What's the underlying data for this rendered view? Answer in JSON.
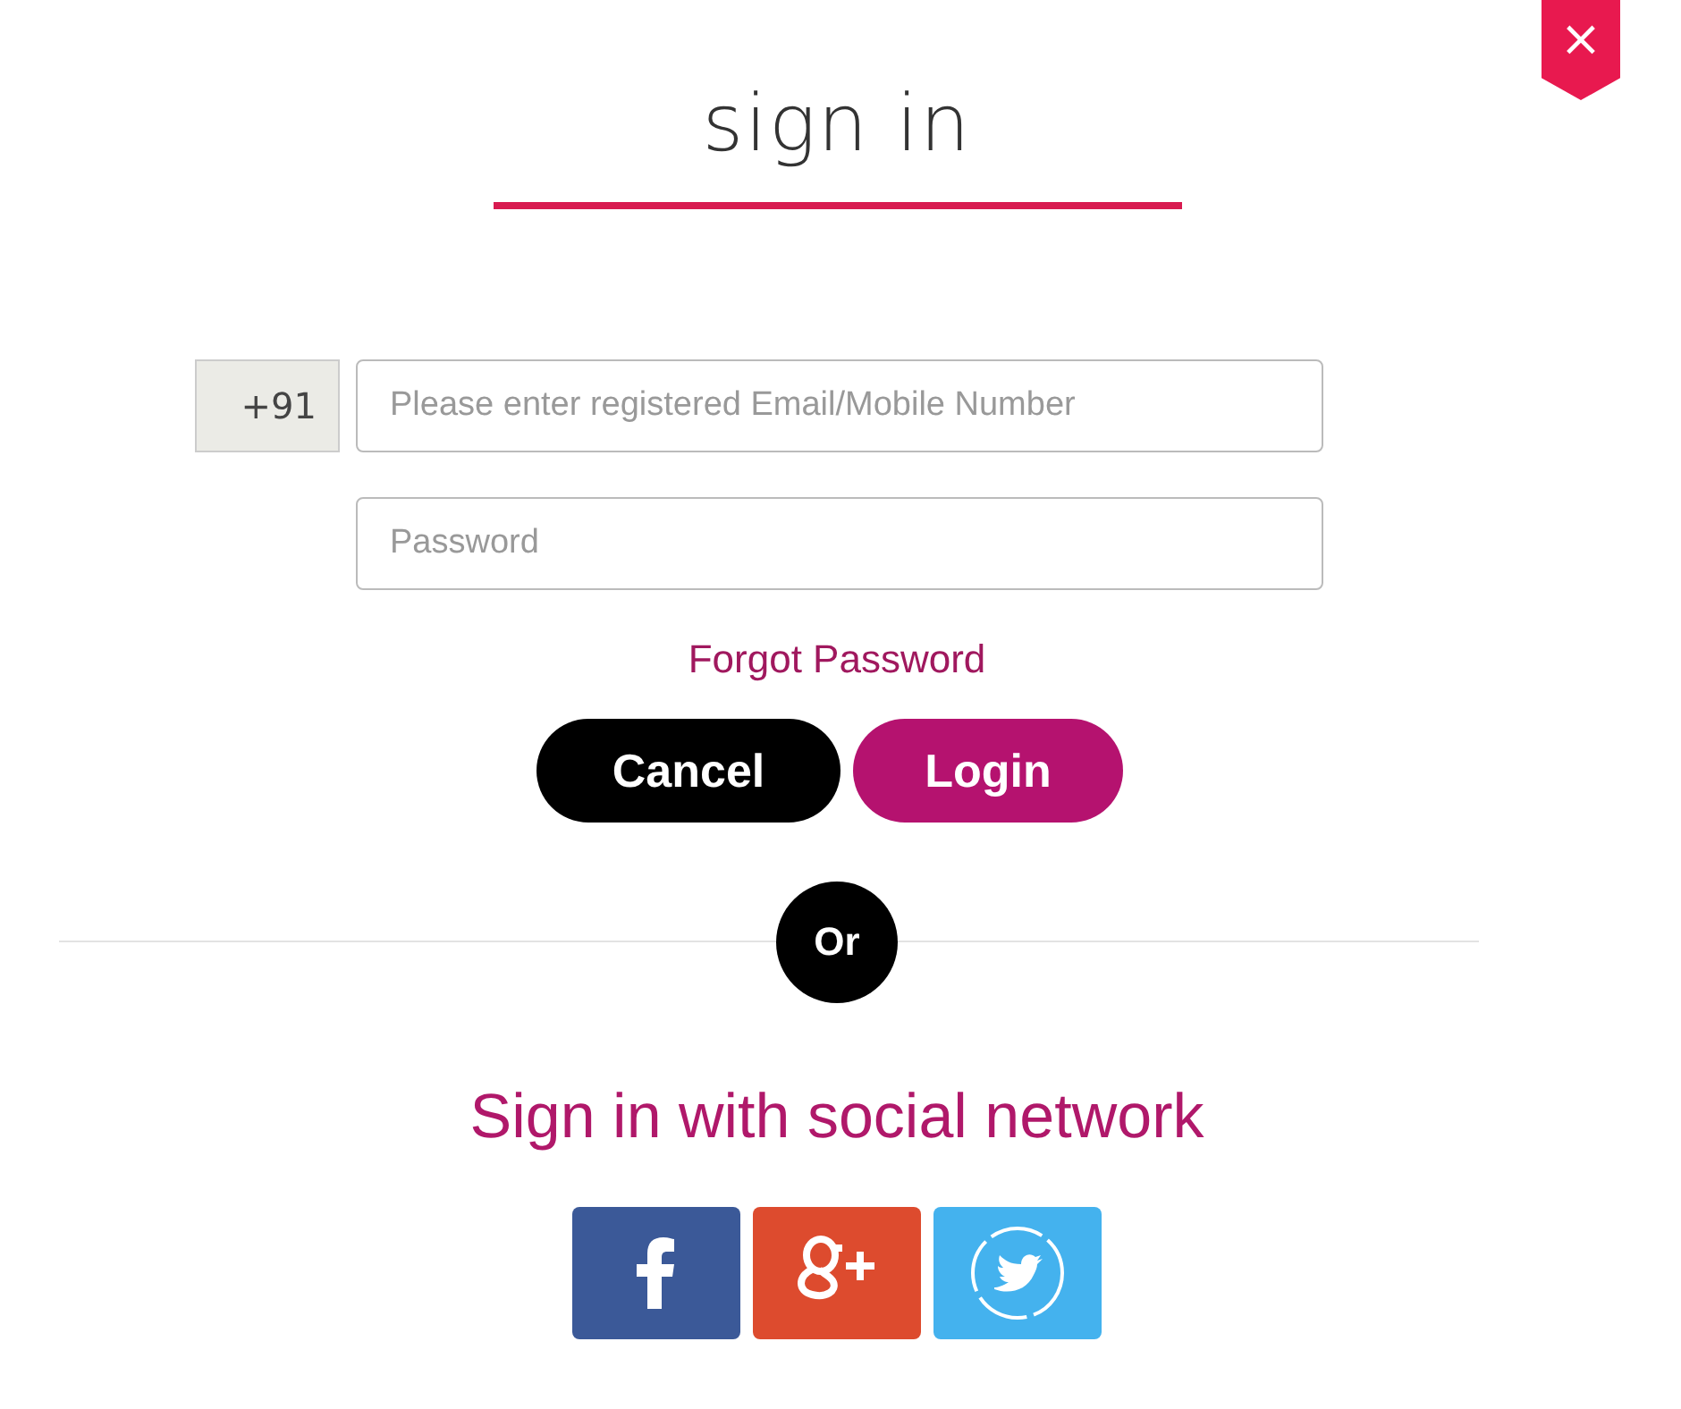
{
  "close_button": {
    "label": "×"
  },
  "title": "sign in",
  "form": {
    "country_code": "+91",
    "login_field": {
      "placeholder": "Please enter registered Email/Mobile Number"
    },
    "password_field": {
      "placeholder": "Password"
    },
    "forgot_link": "Forgot Password"
  },
  "buttons": [
    {
      "label": "Cancel",
      "kind": "cancel"
    },
    {
      "label": "Login",
      "kind": "login"
    }
  ],
  "separator": "Or",
  "social": {
    "heading": "Sign in with social network",
    "networks": [
      {
        "kind": "facebook"
      },
      {
        "kind": "googleplus"
      },
      {
        "kind": "twitter"
      }
    ]
  }
}
